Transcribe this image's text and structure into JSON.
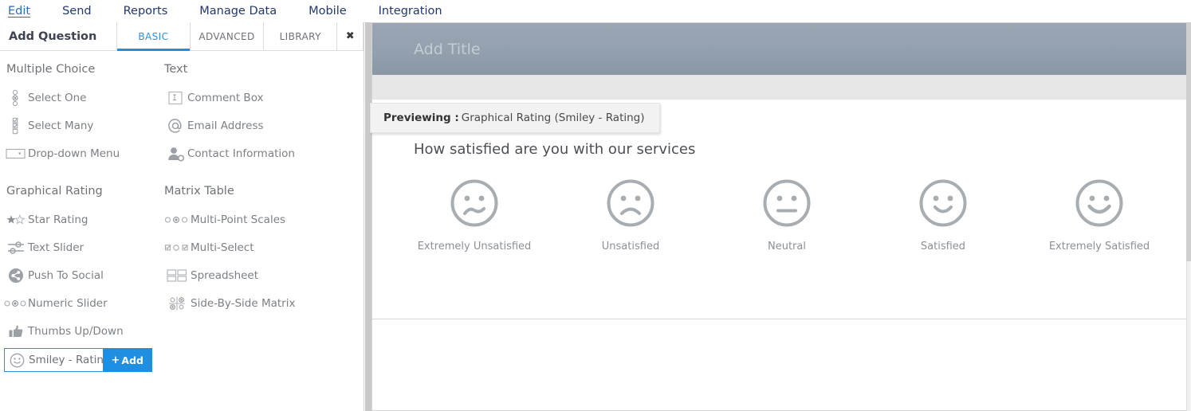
{
  "topnav": {
    "items": [
      {
        "label": "Edit",
        "active": true
      },
      {
        "label": "Send",
        "active": false
      },
      {
        "label": "Reports",
        "active": false
      },
      {
        "label": "Manage Data",
        "active": false
      },
      {
        "label": "Mobile",
        "active": false
      },
      {
        "label": "Integration",
        "active": false
      }
    ]
  },
  "builder": {
    "title": "Add Question",
    "tabs": [
      {
        "label": "BASIC",
        "active": true
      },
      {
        "label": "ADVANCED",
        "active": false
      },
      {
        "label": "LIBRARY",
        "active": false
      }
    ],
    "close_icon": "✖",
    "groups": [
      {
        "title": "Multiple Choice",
        "column": "left",
        "items": [
          {
            "label": "Select One",
            "icon": "radio-list-icon"
          },
          {
            "label": "Select Many",
            "icon": "checkbox-list-icon"
          },
          {
            "label": "Drop-down Menu",
            "icon": "dropdown-icon"
          }
        ]
      },
      {
        "title": "Text",
        "column": "right",
        "items": [
          {
            "label": "Comment Box",
            "icon": "text-box-icon"
          },
          {
            "label": "Email Address",
            "icon": "at-sign-icon"
          },
          {
            "label": "Contact Information",
            "icon": "contact-person-icon"
          }
        ]
      },
      {
        "title": "Graphical Rating",
        "column": "left",
        "items": [
          {
            "label": "Star Rating",
            "icon": "star-icon"
          },
          {
            "label": "Text Slider",
            "icon": "sliders-icon"
          },
          {
            "label": "Push To Social",
            "icon": "share-icon"
          },
          {
            "label": "Numeric Slider",
            "icon": "numeric-slider-icon"
          },
          {
            "label": "Thumbs Up/Down",
            "icon": "thumbs-up-icon"
          },
          {
            "label": "Smiley - Rating",
            "icon": "smiley-icon",
            "selected": true,
            "add_label": "Add",
            "add_plus": "+"
          }
        ]
      },
      {
        "title": "Matrix Table",
        "column": "right",
        "items": [
          {
            "label": "Multi-Point Scales",
            "icon": "multi-point-scale-icon"
          },
          {
            "label": "Multi-Select",
            "icon": "multi-select-icon"
          },
          {
            "label": "Spreadsheet",
            "icon": "spreadsheet-icon"
          },
          {
            "label": "Side-By-Side Matrix",
            "icon": "side-by-side-matrix-icon"
          }
        ]
      }
    ]
  },
  "preview": {
    "title_placeholder": "Add Title",
    "tooltip": {
      "label": "Previewing :",
      "value": "Graphical Rating (Smiley - Rating)"
    },
    "question": "How satisfied are you with our services",
    "options": [
      {
        "label": "Extremely Unsatisfied",
        "face": "very-sad-face-icon"
      },
      {
        "label": "Unsatisfied",
        "face": "sad-face-icon"
      },
      {
        "label": "Neutral",
        "face": "neutral-face-icon"
      },
      {
        "label": "Satisfied",
        "face": "happy-face-icon"
      },
      {
        "label": "Extremely Satisfied",
        "face": "very-happy-face-icon"
      }
    ]
  },
  "colors": {
    "accent_blue": "#1e8fe1",
    "nav_text": "#22386a",
    "header_gray": "#93a0ae",
    "face_gray": "#a8adb2"
  }
}
